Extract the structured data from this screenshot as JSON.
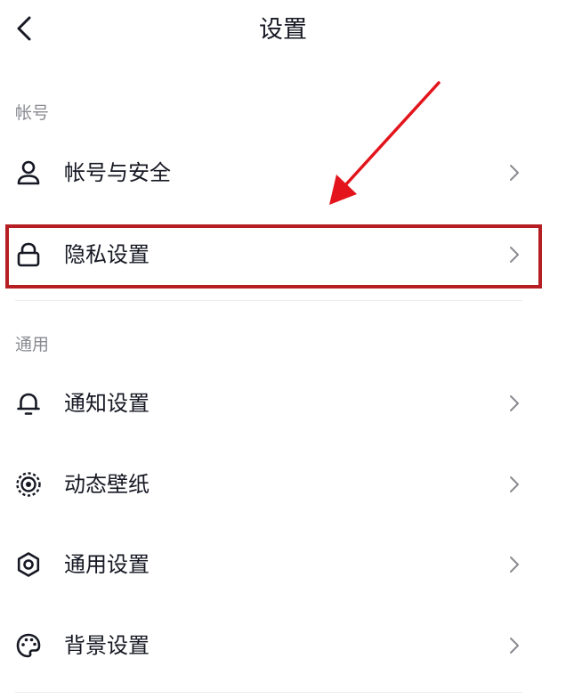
{
  "header": {
    "title": "设置",
    "back_icon": "chevron-left-icon"
  },
  "sections": [
    {
      "label": "帐号",
      "items": [
        {
          "label": "帐号与安全",
          "icon": "user-icon"
        },
        {
          "label": "隐私设置",
          "icon": "lock-icon",
          "highlighted": true
        }
      ]
    },
    {
      "label": "通用",
      "items": [
        {
          "label": "通知设置",
          "icon": "bell-icon"
        },
        {
          "label": "动态壁纸",
          "icon": "live-wallpaper-icon"
        },
        {
          "label": "通用设置",
          "icon": "gear-icon"
        },
        {
          "label": "背景设置",
          "icon": "palette-icon"
        }
      ]
    }
  ],
  "colors": {
    "text": "#161823",
    "section_label": "#8a8b91",
    "chevron": "#8a8b91",
    "divider": "#ececee",
    "annotation_box": "#b51f24",
    "annotation_arrow": "#e3141b"
  }
}
